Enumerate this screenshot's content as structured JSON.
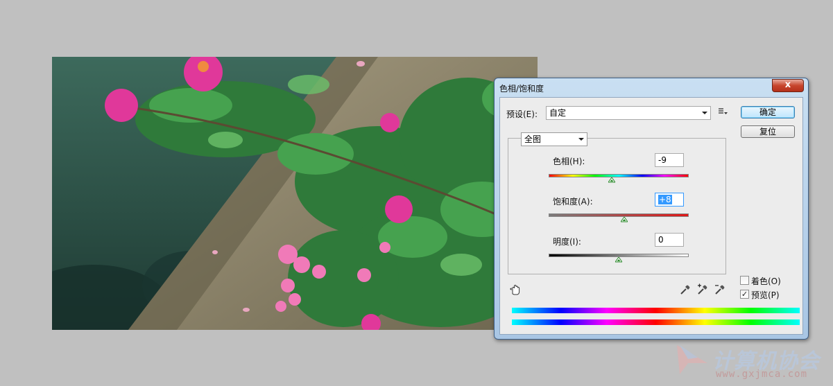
{
  "dialog": {
    "title": "色相/饱和度",
    "close_label": "x",
    "preset_label": "预设(E):",
    "preset_value": "自定",
    "ok_label": "确定",
    "reset_label": "复位",
    "range_value": "全图",
    "hue": {
      "label": "色相(H):",
      "value": "-9",
      "position": 0.45
    },
    "saturation": {
      "label": "饱和度(A):",
      "value": "+8",
      "position": 0.54
    },
    "lightness": {
      "label": "明度(I):",
      "value": "0",
      "position": 0.5
    },
    "colorize": {
      "label": "着色(O)",
      "checked": false
    },
    "preview": {
      "label": "预览(P)",
      "checked": true
    },
    "check_mark": "✓"
  },
  "watermark": {
    "text": "计算机协会",
    "url": "www.gxjmca.com"
  },
  "colors": {
    "saturation_track_start": "#7a7a7a",
    "saturation_track_end": "#e01818",
    "thumb": "#2e8b2e"
  }
}
